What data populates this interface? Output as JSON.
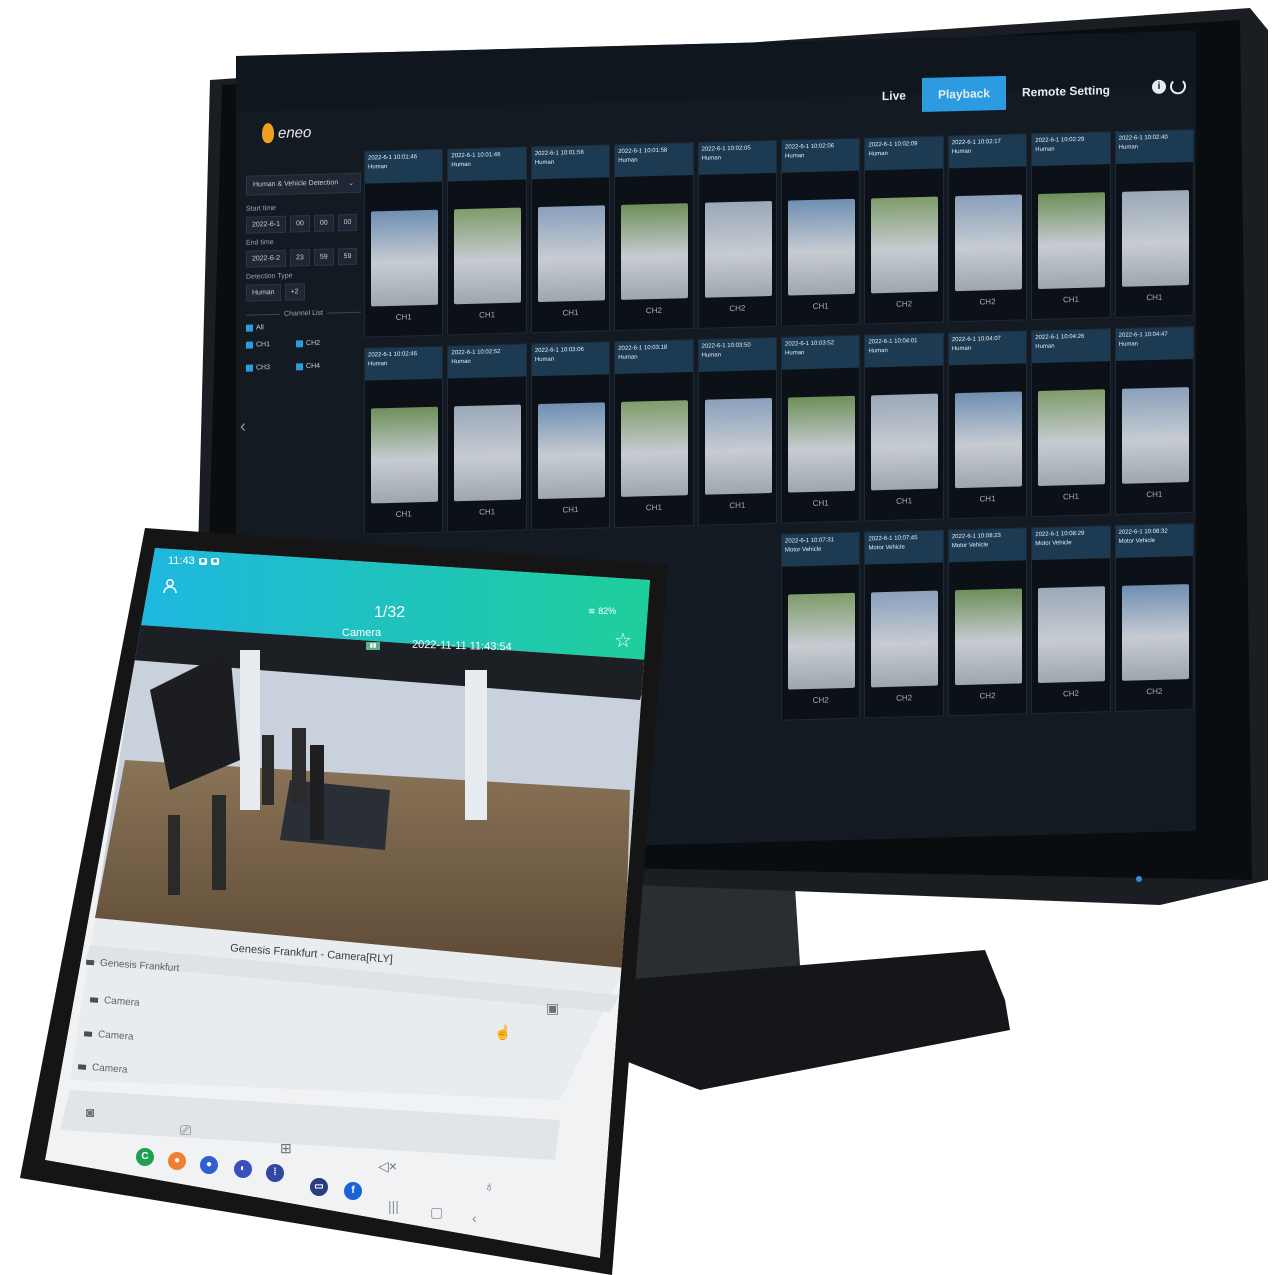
{
  "monitor": {
    "logo": "eneo",
    "nav": {
      "tabs": [
        "Live",
        "Playback",
        "Remote Setting"
      ],
      "active": "Playback"
    },
    "sidebar": {
      "filter": "Human & Vehicle Detection",
      "start_label": "Start time",
      "start_date": "2022-6-1",
      "start_h": "00",
      "start_m": "00",
      "start_s": "00",
      "end_label": "End time",
      "end_date": "2022-6-2",
      "end_h": "23",
      "end_m": "59",
      "end_s": "59",
      "type_label": "Detection Type",
      "type_value": "Human",
      "type_more": "+2",
      "channel_list": "Channel List",
      "all": "All",
      "ch1": "CH1",
      "ch2": "CH2",
      "ch3": "CH3",
      "ch4": "CH4"
    },
    "rows": [
      [
        {
          "time": "2022-6-1 10:01:46",
          "type": "Human",
          "ch": "CH1"
        },
        {
          "time": "2022-6-1 10:01:46",
          "type": "Human",
          "ch": "CH1"
        },
        {
          "time": "2022-6-1 10:01:56",
          "type": "Human",
          "ch": "CH1"
        },
        {
          "time": "2022-6-1 10:01:58",
          "type": "Human",
          "ch": "CH2"
        },
        {
          "time": "2022-6-1 10:02:05",
          "type": "Human",
          "ch": "CH2"
        },
        {
          "time": "2022-6-1 10:02:06",
          "type": "Human",
          "ch": "CH1"
        },
        {
          "time": "2022-6-1 10:02:09",
          "type": "Human",
          "ch": "CH2"
        },
        {
          "time": "2022-6-1 10:02:17",
          "type": "Human",
          "ch": "CH2"
        },
        {
          "time": "2022-6-1 10:02:29",
          "type": "Human",
          "ch": "CH1"
        },
        {
          "time": "2022-6-1 10:02:40",
          "type": "Human",
          "ch": "CH1"
        }
      ],
      [
        {
          "time": "2022-6-1 10:02:46",
          "type": "Human",
          "ch": "CH1"
        },
        {
          "time": "2022-6-1 10:02:52",
          "type": "Human",
          "ch": "CH1"
        },
        {
          "time": "2022-6-1 10:03:06",
          "type": "Human",
          "ch": "CH1"
        },
        {
          "time": "2022-6-1 10:03:18",
          "type": "Human",
          "ch": "CH1"
        },
        {
          "time": "2022-6-1 10:03:50",
          "type": "Human",
          "ch": "CH1"
        },
        {
          "time": "2022-6-1 10:03:52",
          "type": "Human",
          "ch": "CH1"
        },
        {
          "time": "2022-6-1 10:04:01",
          "type": "Human",
          "ch": "CH1"
        },
        {
          "time": "2022-6-1 10:04:07",
          "type": "Human",
          "ch": "CH1"
        },
        {
          "time": "2022-6-1 10:04:26",
          "type": "Human",
          "ch": "CH1"
        },
        {
          "time": "2022-6-1 10:04:47",
          "type": "Human",
          "ch": "CH1"
        }
      ],
      [
        {
          "time": "",
          "type": "",
          "ch": ""
        },
        {
          "time": "",
          "type": "",
          "ch": ""
        },
        {
          "time": "",
          "type": "",
          "ch": ""
        },
        {
          "time": "",
          "type": "",
          "ch": ""
        },
        {
          "time": "",
          "type": "",
          "ch": ""
        },
        {
          "time": "2022-6-1 10:07:31",
          "type": "Motor Vehicle",
          "ch": "CH2"
        },
        {
          "time": "2022-6-1 10:07:45",
          "type": "Motor Vehicle",
          "ch": "CH2"
        },
        {
          "time": "2022-6-1 10:08:23",
          "type": "Motor Vehicle",
          "ch": "CH2"
        },
        {
          "time": "2022-6-1 10:08:29",
          "type": "Motor Vehicle",
          "ch": "CH2"
        },
        {
          "time": "2022-6-1 10:08:32",
          "type": "Motor Vehicle",
          "ch": "CH2"
        }
      ]
    ]
  },
  "tablet": {
    "clock": "11:43",
    "page": "1/32",
    "battery": "82%",
    "camera_name": "Camera",
    "timestamp": "2022-11-11 11:43:54",
    "site_title": "Genesis Frankfurt - Camera[RLY]",
    "group": "Genesis Frankfurt",
    "cameras": [
      "Camera",
      "Camera",
      "Camera"
    ]
  },
  "colors": {
    "accent": "#2c9be0",
    "tablet_header_start": "#1fb7e0",
    "tablet_header_end": "#1fcf9a"
  }
}
